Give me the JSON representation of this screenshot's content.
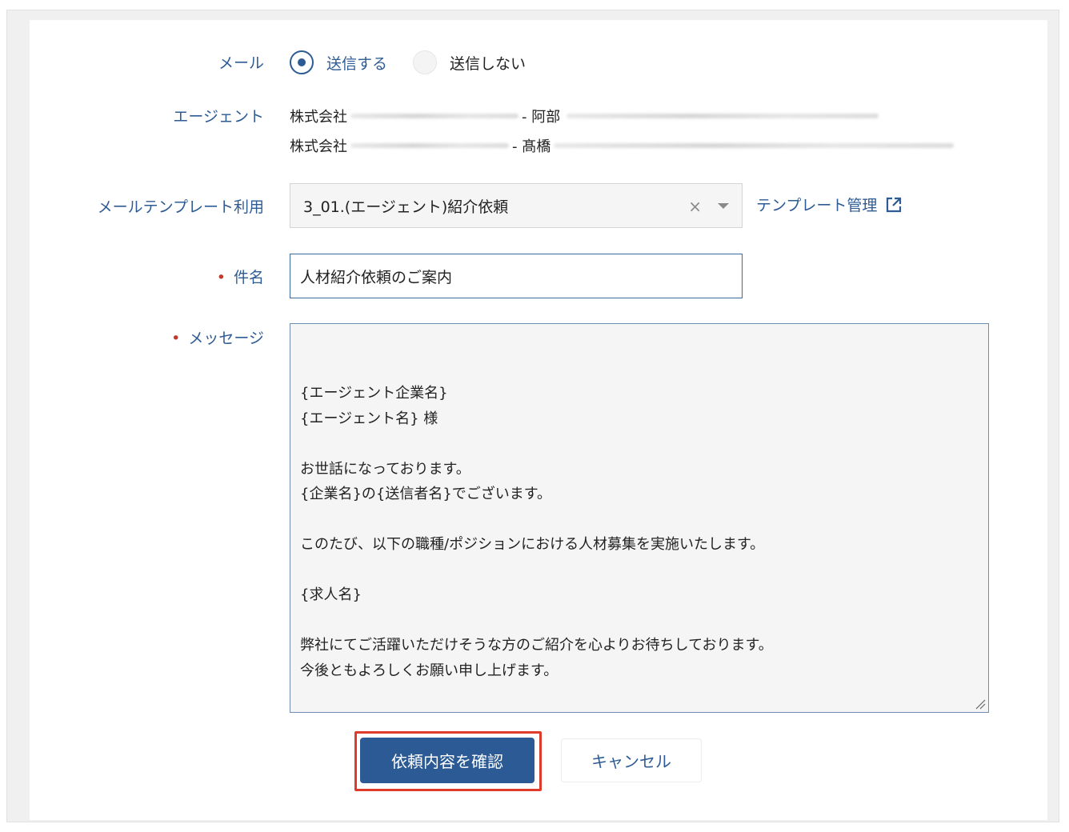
{
  "form": {
    "mail": {
      "label": "メール",
      "options": [
        {
          "label": "送信する",
          "selected": true
        },
        {
          "label": "送信しない",
          "selected": false
        }
      ]
    },
    "agent": {
      "label": "エージェント",
      "lines": [
        {
          "company_prefix": "株式会社",
          "separator": "- 阿部"
        },
        {
          "company_prefix": "株式会社",
          "separator": "- 髙橋"
        }
      ]
    },
    "template": {
      "label": "メールテンプレート利用",
      "selected": "3_01.(エージェント)紹介依頼",
      "clear_symbol": "×",
      "manage_link": "テンプレート管理"
    },
    "subject": {
      "label": "件名",
      "required_mark": "•",
      "value": "人材紹介依頼のご案内"
    },
    "message": {
      "label": "メッセージ",
      "required_mark": "•",
      "value": "{エージェント企業名}\n{エージェント名} 様\n\nお世話になっております。\n{企業名}の{送信者名}でございます。\n\nこのたび、以下の職種/ポジションにおける人材募集を実施いたします。\n\n{求人名}\n\n弊社にてご活躍いただけそうな方のご紹介を心よりお待ちしております。\n今後ともよろしくお願い申し上げます。\n\n{企業名}\n{送信者名}"
    }
  },
  "actions": {
    "confirm_label": "依頼内容を確認",
    "cancel_label": "キャンセル"
  },
  "colors": {
    "accent": "#2e5b93",
    "primary_button": "#2b5a94",
    "required": "#c0392b",
    "highlight_border": "#e03a2b"
  },
  "icons": {
    "external_link": "external-link-icon",
    "dropdown": "chevron-down-icon",
    "clear": "close-icon"
  }
}
